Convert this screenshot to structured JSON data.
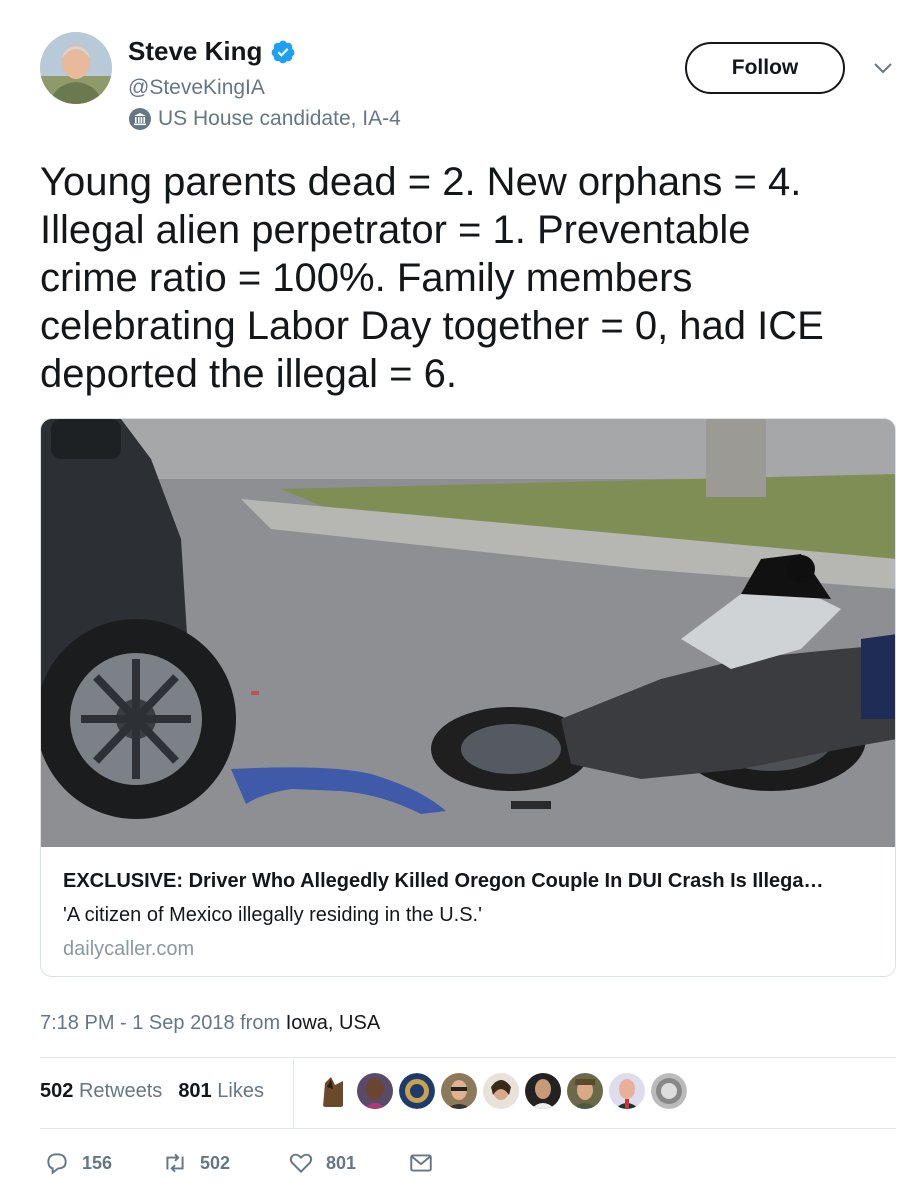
{
  "author": {
    "name": "Steve King",
    "handle": "@SteveKingIA",
    "label": "US House candidate, IA-4",
    "verified": true
  },
  "follow_label": "Follow",
  "tweet_text": "Young parents dead = 2. New orphans = 4.\nIllegal alien perpetrator = 1. Preventable\ncrime ratio = 100%. Family members\ncelebrating Labor Day together = 0, had ICE\ndeported the illegal = 6.",
  "card": {
    "title": "EXCLUSIVE: Driver Who Allegedly Killed Oregon Couple In DUI Crash Is Illega…",
    "description": "'A citizen of Mexico illegally residing in the U.S.'",
    "domain": "dailycaller.com",
    "image_alt": "motorcycle crash scene"
  },
  "timestamp": "7:18 PM - 1 Sep 2018 from ",
  "location": "Iowa, USA",
  "stats": {
    "retweets_count": "502",
    "retweets_label": "Retweets",
    "likes_count": "801",
    "likes_label": "Likes"
  },
  "actions": {
    "replies": "156",
    "retweets": "502",
    "likes": "801"
  },
  "colors": {
    "text": "#14171a",
    "secondary": "#657786",
    "verified_blue": "#1da1f2",
    "border": "#e1e8ed"
  },
  "icons": [
    "verified-badge-icon",
    "government-building-icon",
    "chevron-down-icon",
    "reply-icon",
    "retweet-icon",
    "like-icon",
    "direct-message-icon"
  ]
}
